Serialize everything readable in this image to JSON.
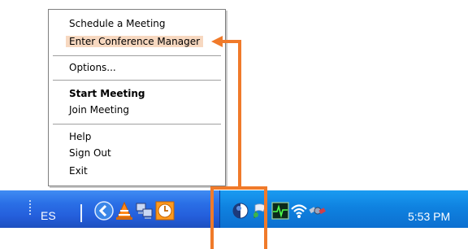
{
  "menu": {
    "items": [
      {
        "label": "Schedule a Meeting"
      },
      {
        "label": "Enter Conference Manager"
      },
      {
        "label": "Options..."
      },
      {
        "label": "Start Meeting"
      },
      {
        "label": "Join Meeting"
      },
      {
        "label": "Help"
      },
      {
        "label": "Sign Out"
      },
      {
        "label": "Exit"
      }
    ]
  },
  "taskbar": {
    "language": "ES",
    "clock": "5:53 PM",
    "quick_launch": [
      "back-arrow-icon",
      "vlc-cone-icon",
      "network-computers-icon",
      "clock-icon"
    ],
    "tray_icons": [
      "meeting-app-icon",
      "tray-flag-icon",
      "activity-monitor-icon",
      "wireless-signal-icon",
      "satellite-icon"
    ]
  },
  "colors": {
    "taskbar": "#245edb",
    "tray": "#0f82e0",
    "highlight": "#f7d8c0",
    "callout": "#f07a2a"
  }
}
